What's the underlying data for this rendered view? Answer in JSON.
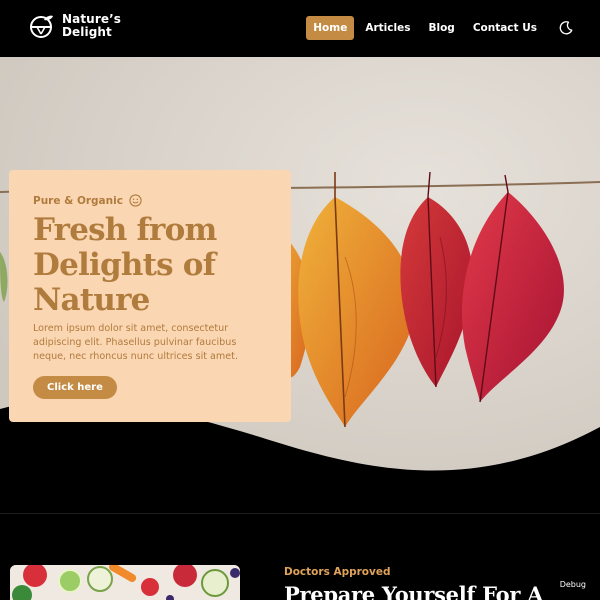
{
  "brand": {
    "name_line1": "Nature’s",
    "name_line2": "Delight",
    "accent": "#c48b45",
    "card_bg": "#fbd6b2",
    "card_text": "#b07c3d"
  },
  "nav": {
    "items": [
      {
        "label": "Home",
        "active": true
      },
      {
        "label": "Articles",
        "active": false
      },
      {
        "label": "Blog",
        "active": false
      },
      {
        "label": "Contact Us",
        "active": false
      }
    ],
    "theme_icon": "moon-icon"
  },
  "hero": {
    "kicker": "Pure & Organic",
    "kicker_icon": "smile-icon",
    "title_line1": "Fresh from",
    "title_line2": "Delights of",
    "title_line3": "Nature",
    "text": "Lorem ipsum dolor sit amet, consectetur adipiscing elit. Phasellus pulvinar faucibus neque, nec rhoncus nunc ultrices sit amet.",
    "cta_label": "Click here"
  },
  "section": {
    "kicker": "Doctors Approved",
    "title": "Prepare Yourself For A"
  },
  "debug_label": "Debug"
}
